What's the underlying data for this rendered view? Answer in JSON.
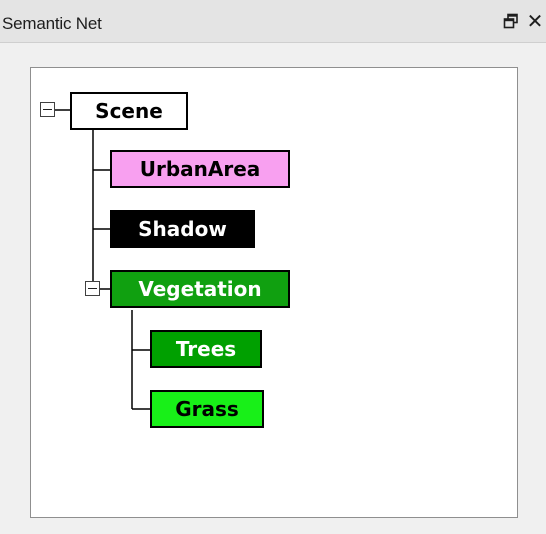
{
  "panel": {
    "title": "Semantic Net",
    "float_icon": "float-window-icon",
    "close_icon": "close-icon",
    "close_glyph": "✕"
  },
  "tree": {
    "root": {
      "label": "Scene",
      "color": "#ffffff",
      "expanded": true
    },
    "children": [
      {
        "label": "UrbanArea",
        "color": "#f8a0f0"
      },
      {
        "label": "Shadow",
        "color": "#000000"
      },
      {
        "label": "Vegetation",
        "color": "#10a010",
        "expanded": true,
        "children": [
          {
            "label": "Trees",
            "color": "#00a000"
          },
          {
            "label": "Grass",
            "color": "#18f018"
          }
        ]
      }
    ]
  }
}
